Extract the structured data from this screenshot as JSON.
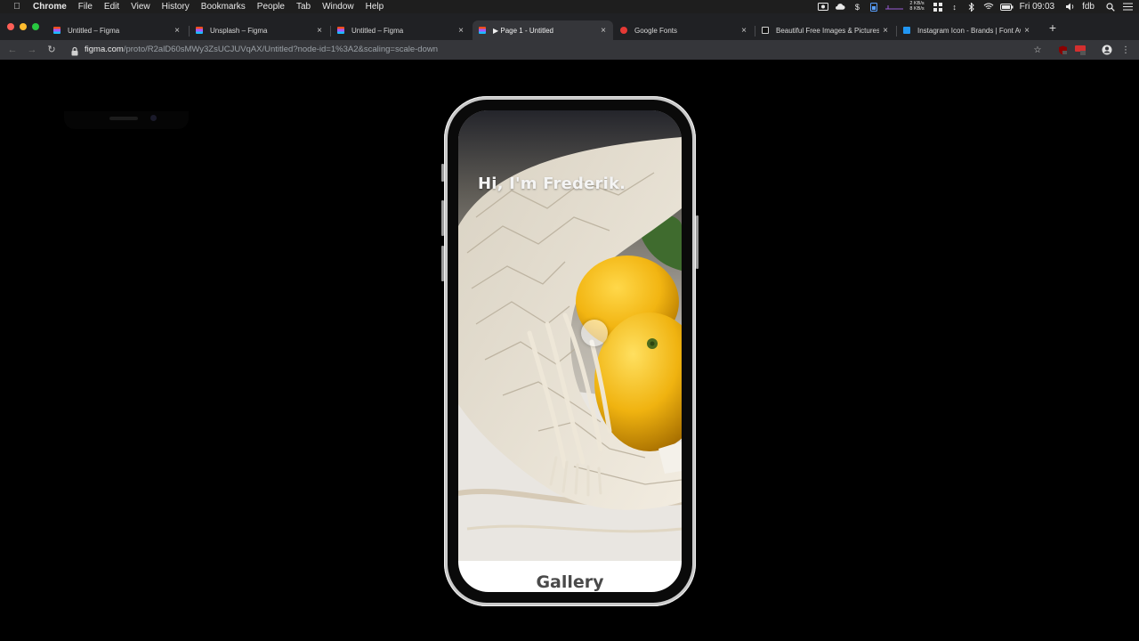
{
  "menubar": {
    "apple_icon": "apple-logo-icon",
    "app_name": "Chrome",
    "items": [
      "File",
      "Edit",
      "View",
      "History",
      "Bookmarks",
      "People",
      "Tab",
      "Window",
      "Help"
    ],
    "net_up": "2 KB/s",
    "net_down": "8 KB/s",
    "clock": "Fri 09:03",
    "user": "fdb"
  },
  "tabs": [
    {
      "label": "Untitled – Figma",
      "favicon": "figma-icon",
      "color": "#a259ff"
    },
    {
      "label": "Unsplash – Figma",
      "favicon": "figma-icon",
      "color": "#a259ff"
    },
    {
      "label": "Untitled – Figma",
      "favicon": "figma-icon",
      "color": "#a259ff"
    },
    {
      "label": "▶ Page 1 - Untitled",
      "favicon": "figma-icon",
      "color": "#a259ff"
    },
    {
      "label": "Google Fonts",
      "favicon": "google-fonts-icon",
      "color": "#e53935"
    },
    {
      "label": "Beautiful Free Images & Pictures",
      "favicon": "unsplash-icon",
      "color": "#cfcfcf"
    },
    {
      "label": "Instagram Icon - Brands | Font Awesome",
      "favicon": "font-awesome-icon",
      "color": "#2196f3"
    }
  ],
  "toolbar": {
    "url_host": "figma.com",
    "url_path": "/proto/R2alD60sMWy3ZsUCJUVqAX/Untitled?node-id=1%3A2&scaling=scale-down"
  },
  "prototype": {
    "hero_title": "Hi, I'm Frederik.",
    "section_title": "Gallery"
  },
  "colors": {
    "chrome_dark": "#202124",
    "toolbar": "#35363a",
    "canvas": "#000000",
    "lemon": "#f2b512"
  }
}
